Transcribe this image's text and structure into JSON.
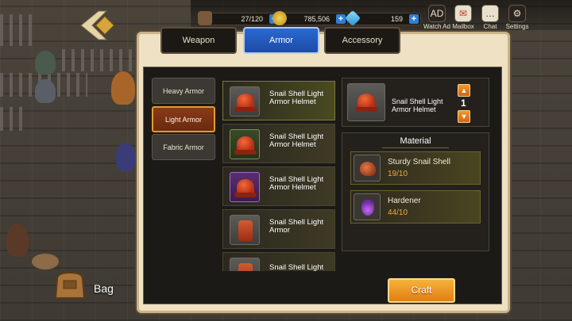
{
  "resources": [
    {
      "icon": "hammer-icon",
      "value": "27/120"
    },
    {
      "icon": "gold-coin-icon",
      "value": "785,506"
    },
    {
      "icon": "gem-icon",
      "value": "159"
    }
  ],
  "top_buttons": [
    {
      "icon": "ad-icon",
      "glyph": "AD",
      "label": "Watch Ad"
    },
    {
      "icon": "mailbox-icon",
      "glyph": "✉",
      "label": "Mailbox"
    },
    {
      "icon": "chat-icon",
      "glyph": "…",
      "label": "Chat"
    },
    {
      "icon": "gear-icon",
      "glyph": "⚙",
      "label": "Settings"
    }
  ],
  "tabs": [
    {
      "label": "Weapon",
      "active": false
    },
    {
      "label": "Armor",
      "active": true
    },
    {
      "label": "Accessory",
      "active": false
    }
  ],
  "categories": [
    {
      "label": "Heavy Armor",
      "active": false
    },
    {
      "label": "Light Armor",
      "active": true
    },
    {
      "label": "Fabric Armor",
      "active": false
    }
  ],
  "items": [
    {
      "name": "Snail Shell Light Armor Helmet",
      "grade": "grey",
      "icon": "helmet-icon"
    },
    {
      "name": "Snail Shell Light Armor Helmet",
      "grade": "green",
      "icon": "helmet-icon"
    },
    {
      "name": "Snail Shell Light Armor Helmet",
      "grade": "purple",
      "icon": "helmet-icon"
    },
    {
      "name": "Snail Shell Light Armor",
      "grade": "grey",
      "icon": "armor-icon"
    },
    {
      "name": "Snail Shell Light",
      "grade": "grey",
      "icon": "armor-icon"
    }
  ],
  "selected": {
    "name": "Snail Shell Light Armor Helmet",
    "quantity": "1"
  },
  "material": {
    "title": "Material",
    "rows": [
      {
        "name": "Sturdy Snail Shell",
        "qty": "19/10",
        "icon": "shell-icon"
      },
      {
        "name": "Hardener",
        "qty": "44/10",
        "icon": "potion-icon"
      }
    ]
  },
  "craft_label": "Craft",
  "bag_label": "Bag",
  "colors": {
    "accent_orange": "#e59a2c",
    "tab_blue": "#2b6ad1",
    "qty_color": "#f2a93c"
  }
}
